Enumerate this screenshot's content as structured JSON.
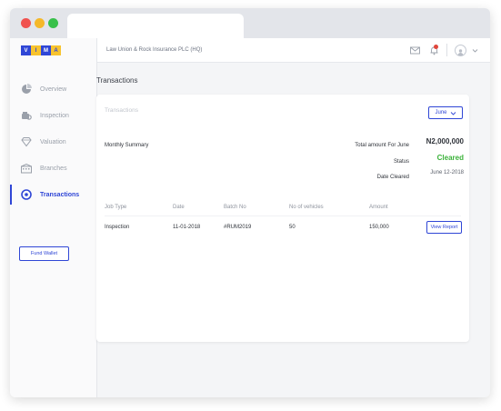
{
  "logo": {
    "letters": [
      "V",
      "I",
      "M",
      "A"
    ]
  },
  "sidebar": {
    "items": [
      {
        "label": "Overview",
        "icon": "pie-chart-icon",
        "active": false
      },
      {
        "label": "Inspection",
        "icon": "car-inspection-icon",
        "active": false
      },
      {
        "label": "Valuation",
        "icon": "diamond-icon",
        "active": false
      },
      {
        "label": "Branches",
        "icon": "building-icon",
        "active": false
      },
      {
        "label": "Transactions",
        "icon": "transactions-icon",
        "active": true
      }
    ],
    "fund_wallet_label": "Fund Wallet"
  },
  "header": {
    "org_name": "Law Union & Rock Insurance PLC (HQ)"
  },
  "page": {
    "title": "Transactions"
  },
  "card": {
    "title": "Transactions",
    "month_selected": "June",
    "summary": {
      "label": "Monthly Summary",
      "total_label": "Total amount For June",
      "total_value": "N2,000,000",
      "status_label": "Status",
      "status_value": "Cleared",
      "date_label": "Date Cleared",
      "date_value": "June 12-2018"
    },
    "table": {
      "headers": [
        "Job Type",
        "Date",
        "Batch No",
        "No of vehicles",
        "Amount"
      ],
      "rows": [
        {
          "job_type": "Inspection",
          "date": "11-01-2018",
          "batch_no": "#RUM2019",
          "vehicles": "50",
          "amount": "150,000",
          "action": "View Report"
        }
      ]
    }
  },
  "colors": {
    "accent": "#2f46d6",
    "success": "#3bb23a",
    "brand_yellow": "#f7c32e"
  }
}
